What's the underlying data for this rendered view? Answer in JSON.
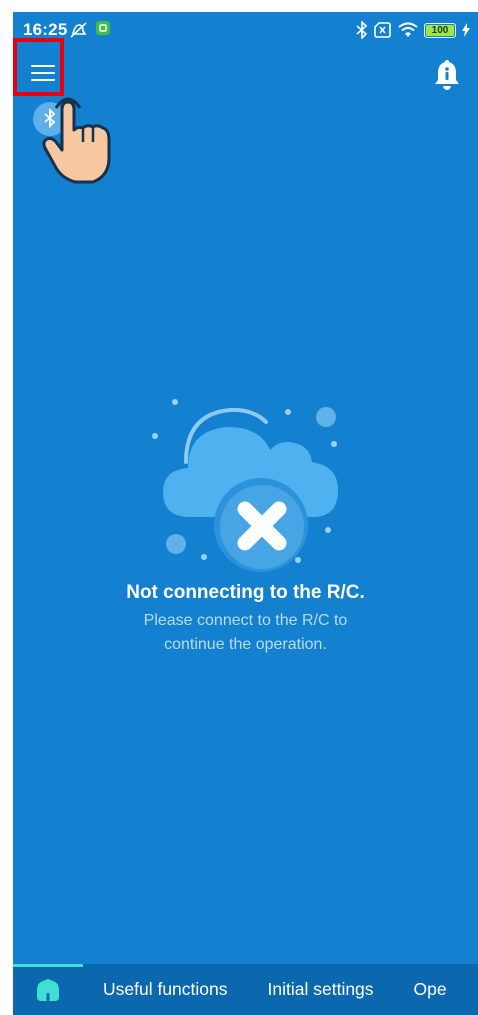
{
  "status_bar": {
    "time": "16:25",
    "battery_level": "100",
    "icons": [
      "do-not-disturb-icon",
      "app-notification-icon",
      "bluetooth-icon",
      "no-sim-icon",
      "wifi-icon",
      "battery-icon",
      "charging-icon"
    ]
  },
  "header": {
    "menu_icon": "hamburger-menu-icon",
    "notification_icon": "bell-info-icon",
    "connection_icon": "bluetooth-icon"
  },
  "message": {
    "title": "Not connecting to the R/C.",
    "body": "Please connect to the R/C to continue the operation."
  },
  "bottom_nav": {
    "home_icon": "home-icon",
    "tabs": [
      {
        "label": "Useful functions"
      },
      {
        "label": "Initial settings"
      },
      {
        "label": "Ope"
      }
    ]
  },
  "colors": {
    "background": "#1381cf",
    "nav_background": "#0b68ae",
    "accent": "#3fe0d4",
    "highlight": "#e60012"
  }
}
